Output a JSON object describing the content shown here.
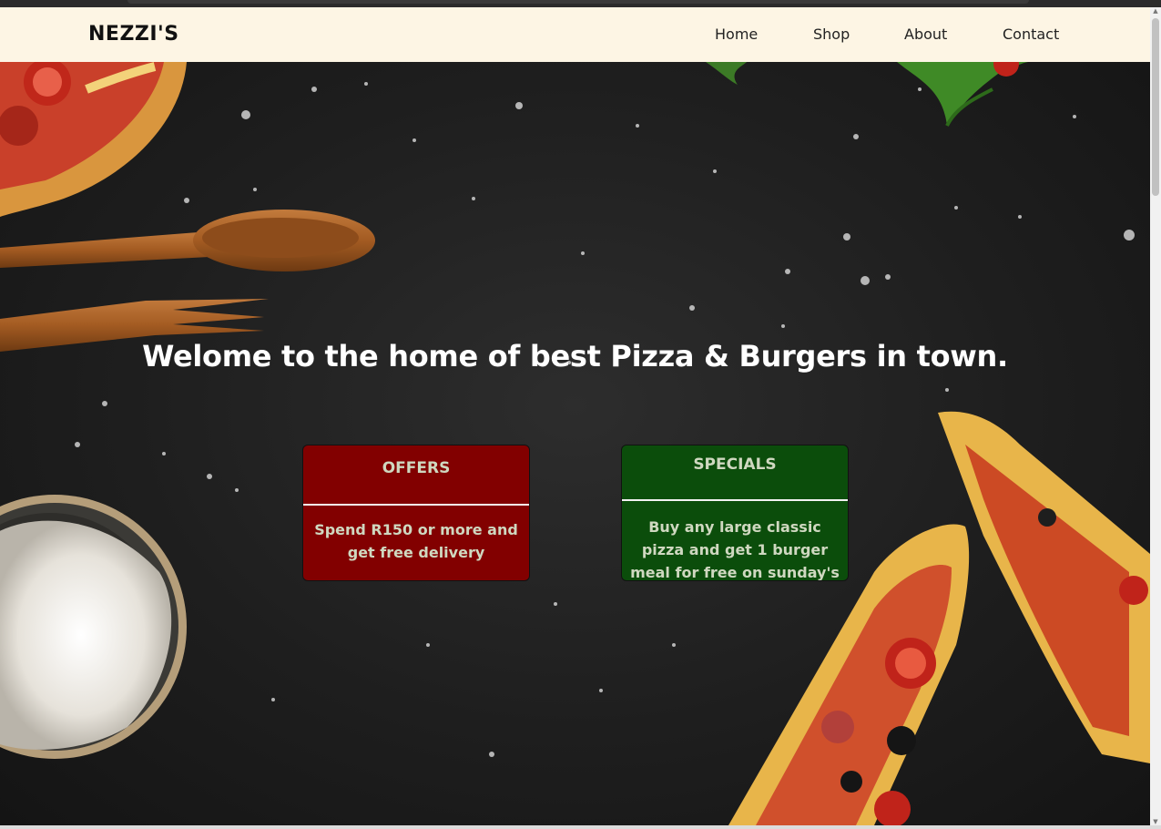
{
  "brand": "NEZZI'S",
  "nav": [
    {
      "label": "Home"
    },
    {
      "label": "Shop"
    },
    {
      "label": "About"
    },
    {
      "label": "Contact"
    }
  ],
  "hero": {
    "headline": "Welome to the home of best Pizza & Burgers in town."
  },
  "cards": {
    "offers": {
      "title": "OFFERS",
      "text": "Spend R150 or more and get free delivery",
      "color": "#820000"
    },
    "specials": {
      "title": "SPECIALS",
      "text": "Buy any large classic pizza and get 1 burger meal for free on sunday's",
      "color": "#0b4d0b"
    }
  },
  "icons": {
    "scroll_up": "triangle-up-icon",
    "scroll_down": "triangle-down-icon"
  }
}
